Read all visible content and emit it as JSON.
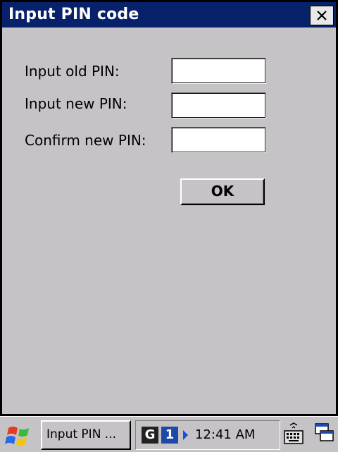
{
  "window": {
    "title": "Input PIN code",
    "close_label": "×"
  },
  "form": {
    "fields": [
      {
        "label": "Input old PIN:",
        "value": ""
      },
      {
        "label": "Input new PIN:",
        "value": ""
      },
      {
        "label": "Confirm new PIN:",
        "value": ""
      }
    ],
    "ok_label": "OK"
  },
  "taskbar": {
    "start_icon": "windows-flag-icon",
    "task_label": "Input PIN ...",
    "tray": {
      "g_label": "G",
      "one_label": "1",
      "clock": "12:41 AM"
    },
    "keyboard_icon": "keyboard-icon",
    "desktop_icon": "desktop-icon"
  },
  "colors": {
    "titlebar": "#08216b",
    "window_bg": "#c6c3c6",
    "tray_blue": "#1d49a8"
  }
}
